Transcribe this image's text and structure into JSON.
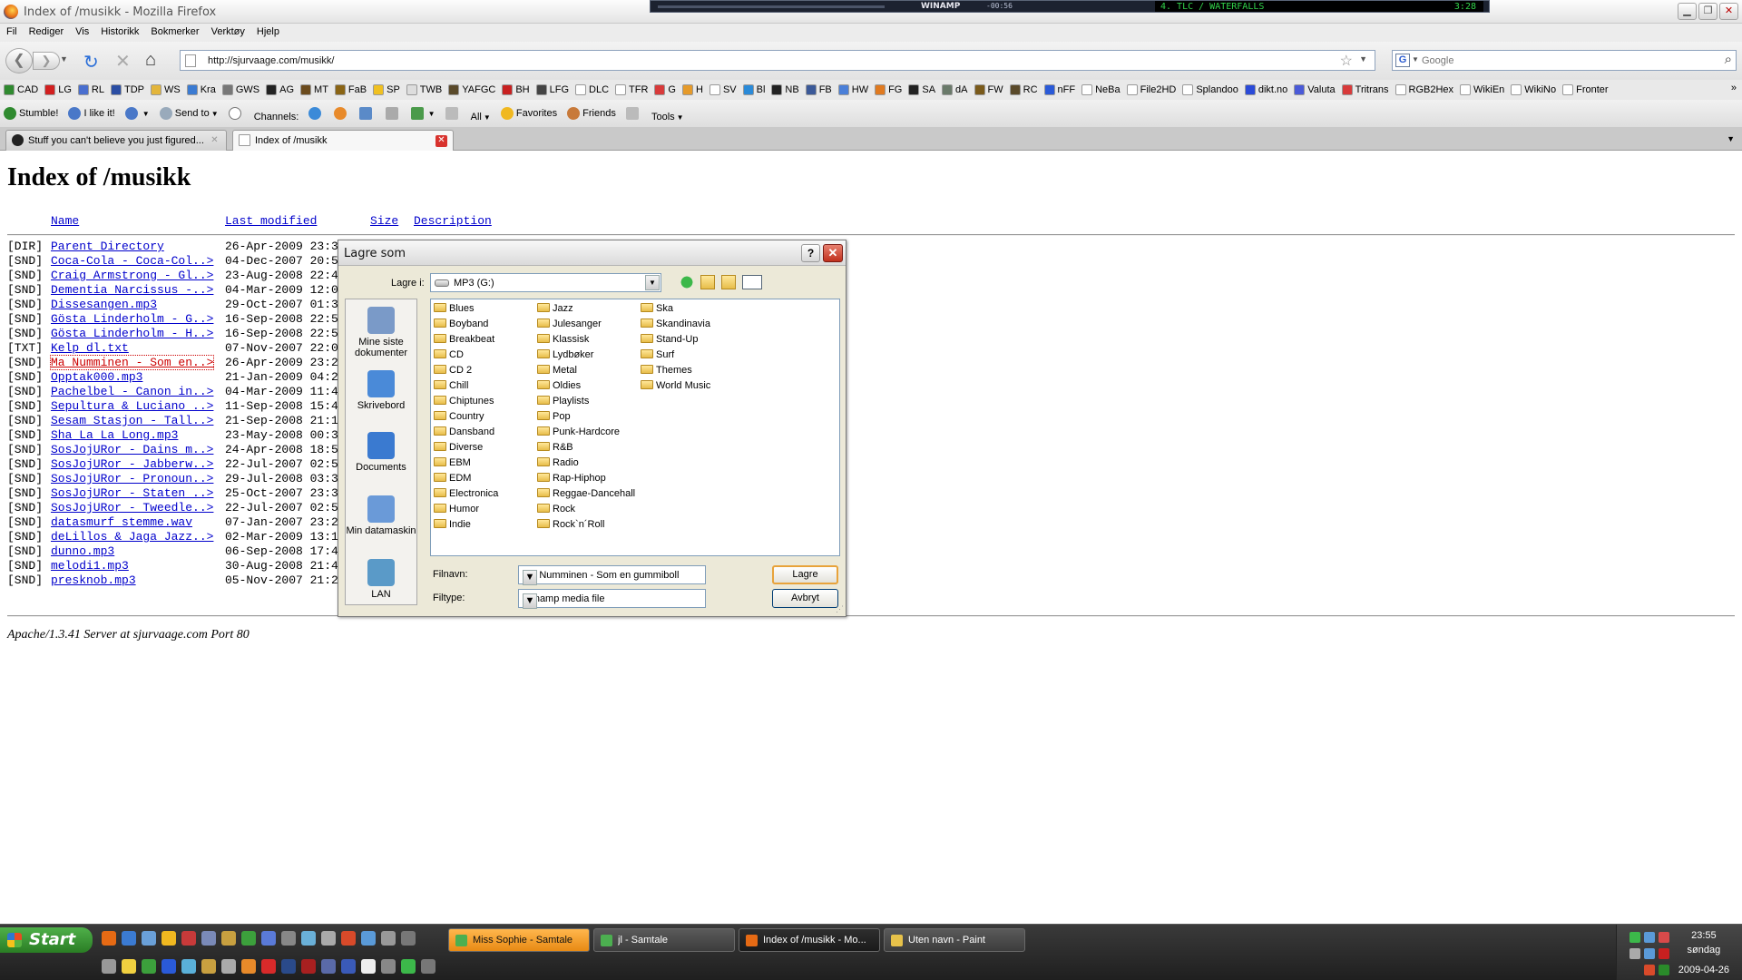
{
  "window": {
    "title": "Index of /musikk - Mozilla Firefox"
  },
  "winamp": {
    "label": "WINAMP",
    "time": "-00:56",
    "song": "4. TLC / WATERFALLS",
    "song_time": "3:28"
  },
  "menu": [
    "Fil",
    "Rediger",
    "Vis",
    "Historikk",
    "Bokmerker",
    "Verktøy",
    "Hjelp"
  ],
  "nav": {
    "url": "http://sjurvaage.com/musikk/",
    "search_placeholder": "Google"
  },
  "bookmarks": [
    {
      "label": "CAD",
      "color": "#2f8a2f"
    },
    {
      "label": "LG",
      "color": "#d21f1f"
    },
    {
      "label": "RL",
      "color": "#4a6fcf"
    },
    {
      "label": "TDP",
      "color": "#2a4da3"
    },
    {
      "label": "WS",
      "color": "#e3b53b"
    },
    {
      "label": "Kra",
      "color": "#3b7bd2"
    },
    {
      "label": "GWS",
      "color": "#777777"
    },
    {
      "label": "AG",
      "color": "#222222"
    },
    {
      "label": "MT",
      "color": "#6b4b1d"
    },
    {
      "label": "FaB",
      "color": "#8a6414"
    },
    {
      "label": "SP",
      "color": "#f0c020"
    },
    {
      "label": "TWB",
      "color": "#dddddd"
    },
    {
      "label": "YAFGC",
      "color": "#5a4a2a"
    },
    {
      "label": "BH",
      "color": "#c82020"
    },
    {
      "label": "LFG",
      "color": "#444444"
    },
    {
      "label": "DLC",
      "color": "#ffffff"
    },
    {
      "label": "TFR",
      "color": "#ffffff"
    },
    {
      "label": "G",
      "color": "#d83a3a"
    },
    {
      "label": "H",
      "color": "#e59a2a"
    },
    {
      "label": "SV",
      "color": "#ffffff"
    },
    {
      "label": "Bl",
      "color": "#2a8ad8"
    },
    {
      "label": "NB",
      "color": "#222222"
    },
    {
      "label": "FB",
      "color": "#3b5998"
    },
    {
      "label": "HW",
      "color": "#4a7fd8"
    },
    {
      "label": "FG",
      "color": "#e07a20"
    },
    {
      "label": "SA",
      "color": "#222222"
    },
    {
      "label": "dA",
      "color": "#6a7a6a"
    },
    {
      "label": "FW",
      "color": "#7a5a1a"
    },
    {
      "label": "RC",
      "color": "#5a4a2a"
    },
    {
      "label": "nFF",
      "color": "#2a5ad8"
    },
    {
      "label": "NeBa",
      "color": "#ffffff"
    },
    {
      "label": "File2HD",
      "color": "#ffffff"
    },
    {
      "label": "Splandoo",
      "color": "#ffffff"
    },
    {
      "label": "dikt.no",
      "color": "#2a4ad8"
    },
    {
      "label": "Valuta",
      "color": "#4a5ad8"
    },
    {
      "label": "Tritrans",
      "color": "#d83a3a"
    },
    {
      "label": "RGB2Hex",
      "color": "#ffffff"
    },
    {
      "label": "WikiEn",
      "color": "#ffffff"
    },
    {
      "label": "WikiNo",
      "color": "#ffffff"
    },
    {
      "label": "Fronter",
      "color": "#ffffff"
    }
  ],
  "stumble": {
    "stumble": "Stumble!",
    "like": "I like it!",
    "send": "Send to",
    "channels": "Channels:",
    "all": "All",
    "favorites": "Favorites",
    "friends": "Friends",
    "tools": "Tools"
  },
  "tabs": [
    {
      "label": "Stuff you can't believe you just figured...",
      "active": false
    },
    {
      "label": "Index of /musikk",
      "active": true
    }
  ],
  "page": {
    "title": "Index of /musikk",
    "headers": {
      "name": "Name",
      "modified": "Last modified",
      "size": "Size",
      "description": "Description"
    },
    "rows": [
      {
        "type": "[DIR]",
        "name": "Parent Directory",
        "date": "26-Apr-2009 23:3"
      },
      {
        "type": "[SND]",
        "name": "Coca-Cola - Coca-Col..>",
        "date": "04-Dec-2007 20:5"
      },
      {
        "type": "[SND]",
        "name": "Craig Armstrong - Gl..>",
        "date": "23-Aug-2008 22:4"
      },
      {
        "type": "[SND]",
        "name": "Dementia Narcissus -..>",
        "date": "04-Mar-2009 12:0"
      },
      {
        "type": "[SND]",
        "name": "Dissesangen.mp3",
        "date": "29-Oct-2007 01:3"
      },
      {
        "type": "[SND]",
        "name": "Gösta Linderholm - G..>",
        "date": "16-Sep-2008 22:5"
      },
      {
        "type": "[SND]",
        "name": "Gösta Linderholm - H..>",
        "date": "16-Sep-2008 22:5"
      },
      {
        "type": "[TXT]",
        "name": "Kelp dl.txt",
        "date": "07-Nov-2007 22:0"
      },
      {
        "type": "[SND]",
        "name": "Ma Numminen - Som en..>",
        "date": "26-Apr-2009 23:2",
        "visited": true
      },
      {
        "type": "[SND]",
        "name": "Opptak000.mp3",
        "date": "21-Jan-2009 04:2"
      },
      {
        "type": "[SND]",
        "name": "Pachelbel - Canon in..>",
        "date": "04-Mar-2009 11:4"
      },
      {
        "type": "[SND]",
        "name": "Sepultura & Luciano ..>",
        "date": "11-Sep-2008 15:4"
      },
      {
        "type": "[SND]",
        "name": "Sesam Stasjon - Tall..>",
        "date": "21-Sep-2008 21:1"
      },
      {
        "type": "[SND]",
        "name": "Sha La La Long.mp3",
        "date": "23-May-2008 00:3"
      },
      {
        "type": "[SND]",
        "name": "SosJojURor - Dains m..>",
        "date": "24-Apr-2008 18:5"
      },
      {
        "type": "[SND]",
        "name": "SosJojURor - Jabberw..>",
        "date": "22-Jul-2007 02:5"
      },
      {
        "type": "[SND]",
        "name": "SosJojURor - Pronoun..>",
        "date": "29-Jul-2008 03:3"
      },
      {
        "type": "[SND]",
        "name": "SosJojURor - Staten ..>",
        "date": "25-Oct-2007 23:3"
      },
      {
        "type": "[SND]",
        "name": "SosJojURor - Tweedle..>",
        "date": "22-Jul-2007 02:5"
      },
      {
        "type": "[SND]",
        "name": "datasmurf stemme.wav",
        "date": "07-Jan-2007 23:2"
      },
      {
        "type": "[SND]",
        "name": "deLillos & Jaga Jazz..>",
        "date": "02-Mar-2009 13:1"
      },
      {
        "type": "[SND]",
        "name": "dunno.mp3",
        "date": "06-Sep-2008 17:4"
      },
      {
        "type": "[SND]",
        "name": "melodi1.mp3",
        "date": "30-Aug-2008 21:4"
      },
      {
        "type": "[SND]",
        "name": "presknob.mp3",
        "date": "05-Nov-2007 21:2"
      }
    ],
    "address": "Apache/1.3.41 Server at sjurvaage.com Port 80"
  },
  "dialog": {
    "title": "Lagre som",
    "save_in_label": "Lagre i:",
    "save_in_value": "MP3 (G:)",
    "places": [
      {
        "label": "Mine siste dokumenter",
        "icon": "recent-docs-icon"
      },
      {
        "label": "Skrivebord",
        "icon": "desktop-icon"
      },
      {
        "label": "Documents",
        "icon": "documents-icon"
      },
      {
        "label": "Min datamaskin",
        "icon": "computer-icon"
      },
      {
        "label": "LAN",
        "icon": "network-icon"
      }
    ],
    "folders": [
      [
        "Blues",
        "Boyband",
        "Breakbeat",
        "CD",
        "CD 2",
        "Chill",
        "Chiptunes",
        "Country",
        "Dansband",
        "Diverse",
        "EBM",
        "EDM",
        "Electronica",
        "Humor",
        "Indie"
      ],
      [
        "Jazz",
        "Julesanger",
        "Klassisk",
        "Lydbøker",
        "Metal",
        "Oldies",
        "Playlists",
        "Pop",
        "Punk-Hardcore",
        "R&B",
        "Radio",
        "Rap-Hiphop",
        "Reggae-Dancehall",
        "Rock",
        "Rock`n´Roll"
      ],
      [
        "Ska",
        "Skandinavia",
        "Stand-Up",
        "Surf",
        "Themes",
        "World Music"
      ]
    ],
    "filename_label": "Filnavn:",
    "filename_value": "Ma Numminen - Som en gummiboll",
    "filetype_label": "Filtype:",
    "filetype_value": "Winamp media file",
    "save_button": "Lagre",
    "cancel_button": "Avbryt"
  },
  "taskbar": {
    "start": "Start",
    "tasks": [
      {
        "label": "Miss Sophie - Samtale",
        "state": "flash",
        "color": "#4caf50"
      },
      {
        "label": "jl - Samtale",
        "state": "normal",
        "color": "#4caf50"
      },
      {
        "label": "Index of /musikk - Mo...",
        "state": "active",
        "color": "#e66a14"
      },
      {
        "label": "Uten navn - Paint",
        "state": "normal",
        "color": "#e7c24a"
      }
    ],
    "clock_time": "23:55",
    "clock_day": "søndag",
    "clock_date": "2009-04-26"
  }
}
